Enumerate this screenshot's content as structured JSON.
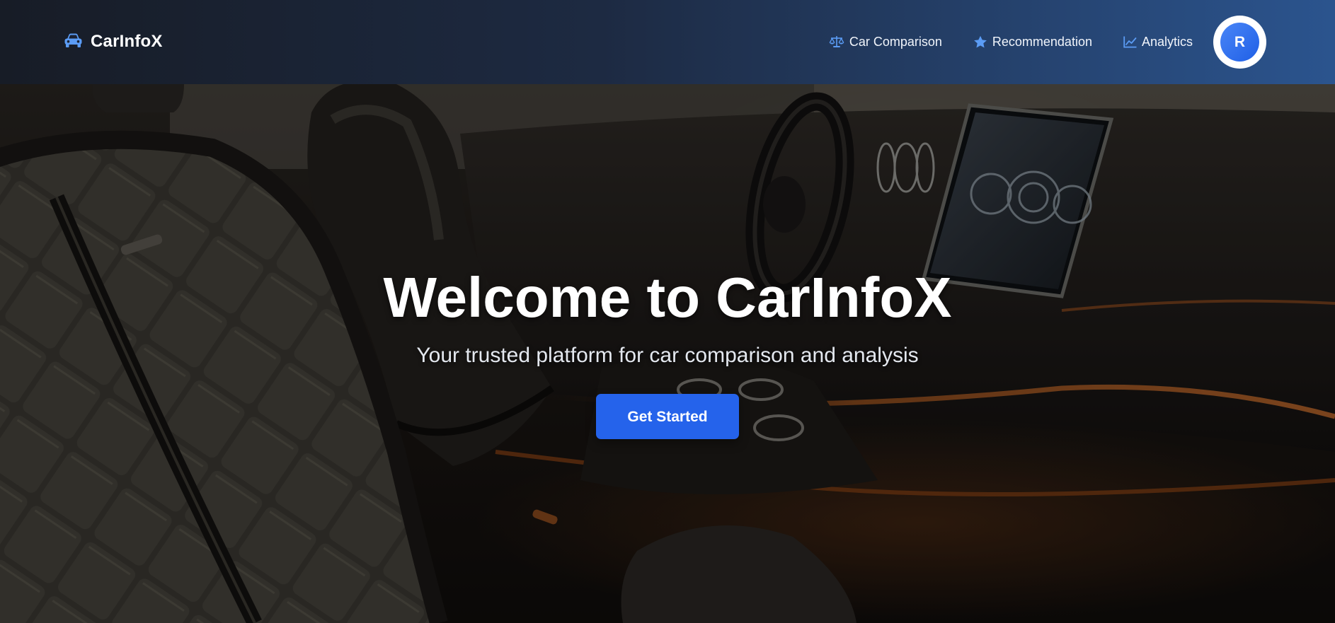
{
  "brand": {
    "name": "CarInfoX",
    "icon": "car-icon"
  },
  "nav": {
    "items": [
      {
        "label": "Car Comparison",
        "icon": "scale-icon"
      },
      {
        "label": "Recommendation",
        "icon": "star-icon"
      },
      {
        "label": "Analytics",
        "icon": "chart-line-icon"
      }
    ]
  },
  "user": {
    "initial": "R"
  },
  "hero": {
    "title": "Welcome to CarInfoX",
    "subtitle": "Your trusted platform for car comparison and analysis",
    "cta_label": "Get Started",
    "background": "luxury-car-interior-photo"
  },
  "colors": {
    "accent": "#2563eb",
    "nav_icon": "#5b9cf5",
    "nav_gradient_start": "#171c26",
    "nav_gradient_end": "#2b548e"
  }
}
